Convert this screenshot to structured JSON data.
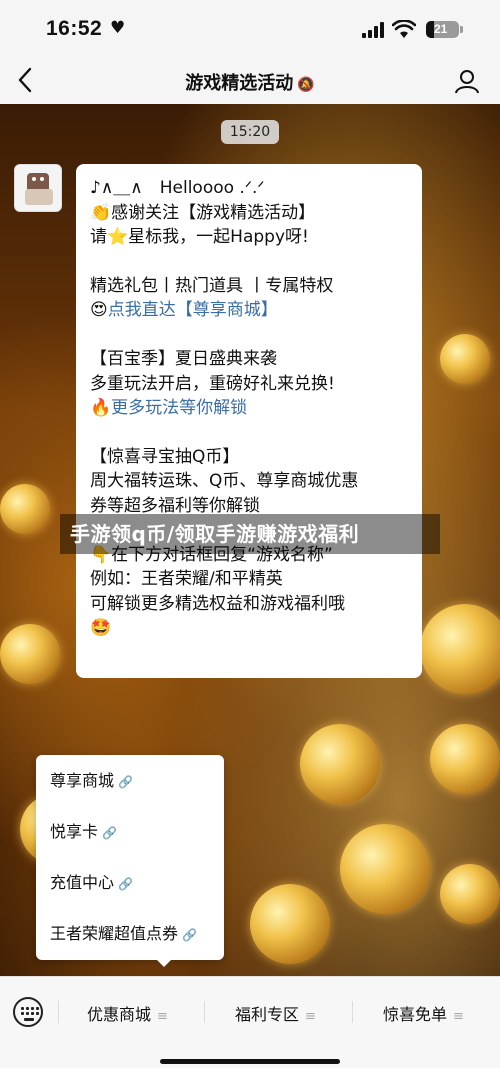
{
  "status_bar": {
    "time": "16:52",
    "battery": "21"
  },
  "nav": {
    "title": "游戏精选活动"
  },
  "chat": {
    "timestamp": "15:20"
  },
  "message": {
    "line1": "♪∧＿∧　Helloooo .ᐟ.ᐟ",
    "line2": "👏感谢关注【游戏精选活动】",
    "line3": "请⭐星标我，一起Happy呀!",
    "line4": "精选礼包丨热门道具 丨专属特权",
    "line5_prefix": "😍",
    "line5_link": "点我直达【尊享商城】",
    "line6": "【百宝季】夏日盛典来袭",
    "line7": "多重玩法开启，重磅好礼来兑换!",
    "line8_prefix": "🔥",
    "line8_link": "更多玩法等你解锁",
    "line9": "【惊喜寻宝抽Q币】",
    "line10": "周大福转运珠、Q币、尊享商城优惠",
    "line11": "券等超多福利等你解锁",
    "line12": "👇在下方对话框回复“游戏名称”",
    "line13": "例如：王者荣耀/和平精英",
    "line14": "可解锁更多精选权益和游戏福利哦",
    "line15": "🤩"
  },
  "overlay_caption": "手游领q币/领取手游赚游戏福利",
  "menu": {
    "items": [
      {
        "label": "尊享商城"
      },
      {
        "label": "悦享卡"
      },
      {
        "label": "充值中心"
      },
      {
        "label": "王者荣耀超值点券"
      }
    ]
  },
  "bottom_tabs": [
    {
      "label": "优惠商城"
    },
    {
      "label": "福利专区"
    },
    {
      "label": "惊喜免单"
    }
  ],
  "icons": [
    "heart-icon",
    "signal-icon",
    "wifi-icon",
    "battery-icon",
    "back-arrow-icon",
    "mute-icon",
    "person-icon",
    "keyboard-icon",
    "link-icon",
    "menu-lines-icon"
  ]
}
